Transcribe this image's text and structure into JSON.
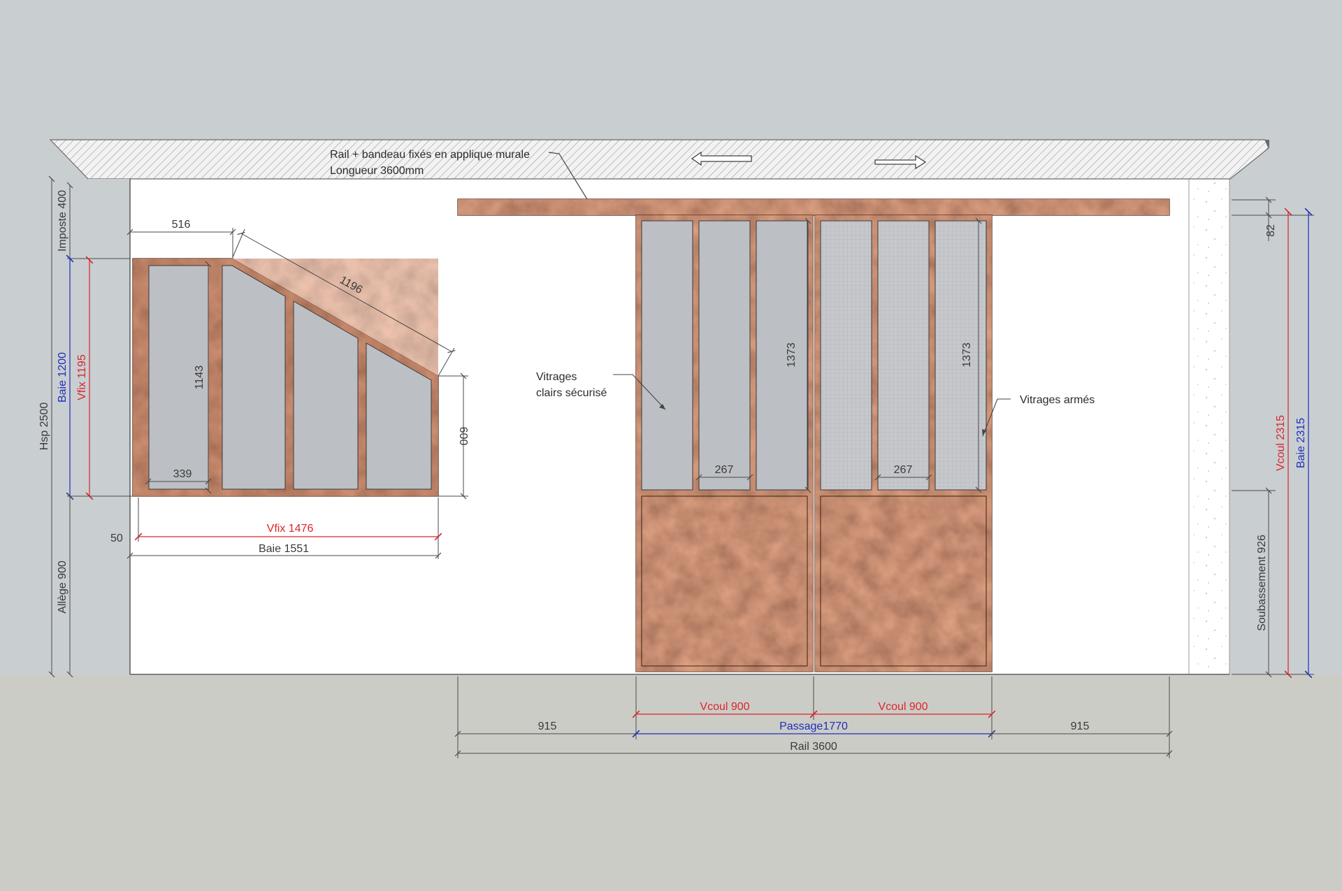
{
  "colors": {
    "sky": "#c9ced1",
    "ground": "#ccccc7",
    "wall": "#ffffff",
    "rust": "#8a4a30",
    "glass": "#bcbfc4",
    "dim_black": "#3a3a3a",
    "dim_red": "#d9262b",
    "dim_blue": "#1f2fb8"
  },
  "annotations": {
    "rail_note_line1": "Rail + bandeau fixés en applique murale",
    "rail_note_line2": "Longueur 3600mm",
    "clear_glass_line1": "Vitrages",
    "clear_glass_line2": "clairs sécurisé",
    "wired_glass": "Vitrages armés"
  },
  "dimensions": {
    "window_top_width": "516",
    "window_slope": "1196",
    "window_right_height": "600",
    "window_inner_height": "1143",
    "window_bottom_left": "339",
    "window_vfix_width": "Vfix 1476",
    "window_baie_width": "Baie 1551",
    "window_offset": "50",
    "imposte": "Imposte 400",
    "hsp": "Hsp 2500",
    "baie_height": "Baie 1200",
    "vfix_height": "Vfix 1195",
    "allege": "Allège 900",
    "door_glass_height_left": "1373",
    "door_glass_height_right": "1373",
    "door_pane_left": "267",
    "door_pane_right": "267",
    "right_gap": "82",
    "vcoul_height": "Vcoul 2315",
    "baie_right_height": "Baie 2315",
    "soubassement": "Soubassement 926",
    "vcoul_left": "Vcoul 900",
    "vcoul_right": "Vcoul 900",
    "passage": "Passage1770",
    "side_left": "915",
    "side_right": "915",
    "rail": "Rail 3600"
  }
}
